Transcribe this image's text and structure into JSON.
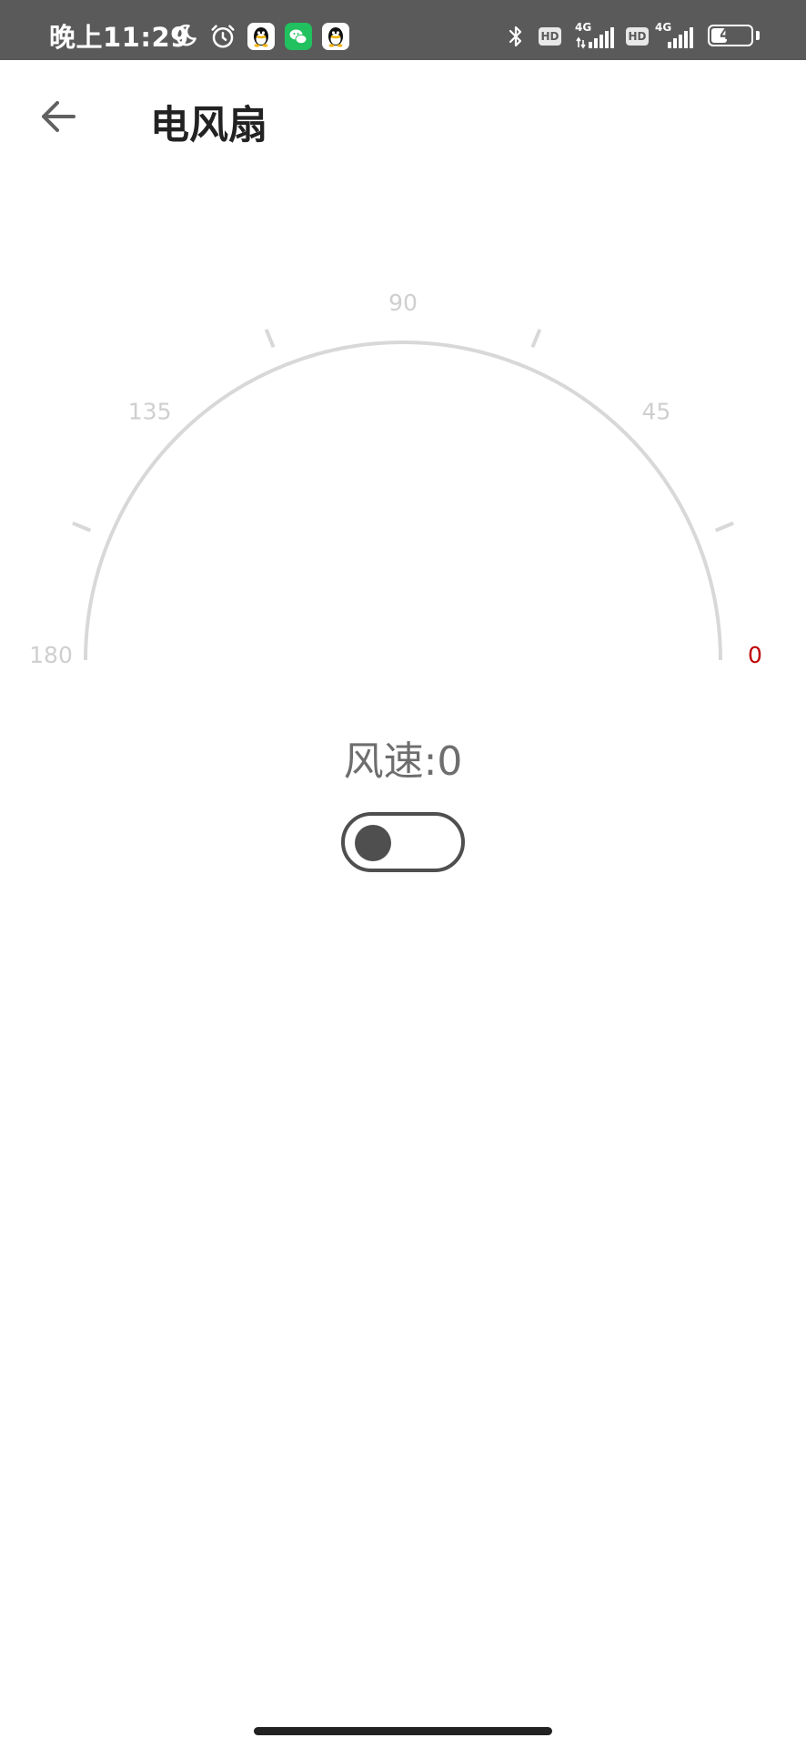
{
  "status_bar": {
    "time": "晚上11:29",
    "network_1": "4G",
    "network_2": "4G",
    "hd_1": "HD",
    "hd_2": "HD",
    "battery_level": "46",
    "battery_fraction": 0.46
  },
  "app_bar": {
    "title": "电风扇"
  },
  "gauge": {
    "min": 0,
    "max": 180,
    "value": 0,
    "tick_labels": [
      {
        "label": "180",
        "value": 180
      },
      {
        "label": "135",
        "value": 135
      },
      {
        "label": "90",
        "value": 90
      },
      {
        "label": "45",
        "value": 45
      },
      {
        "label": "0",
        "value": 0
      }
    ],
    "track_color": "#d8d8d8",
    "label_color": "#cfcfcf",
    "active_color": "#c00000"
  },
  "speed": {
    "label": "风速:",
    "value": "0"
  },
  "power_switch": {
    "on": false,
    "color": "#4f4f4f"
  }
}
